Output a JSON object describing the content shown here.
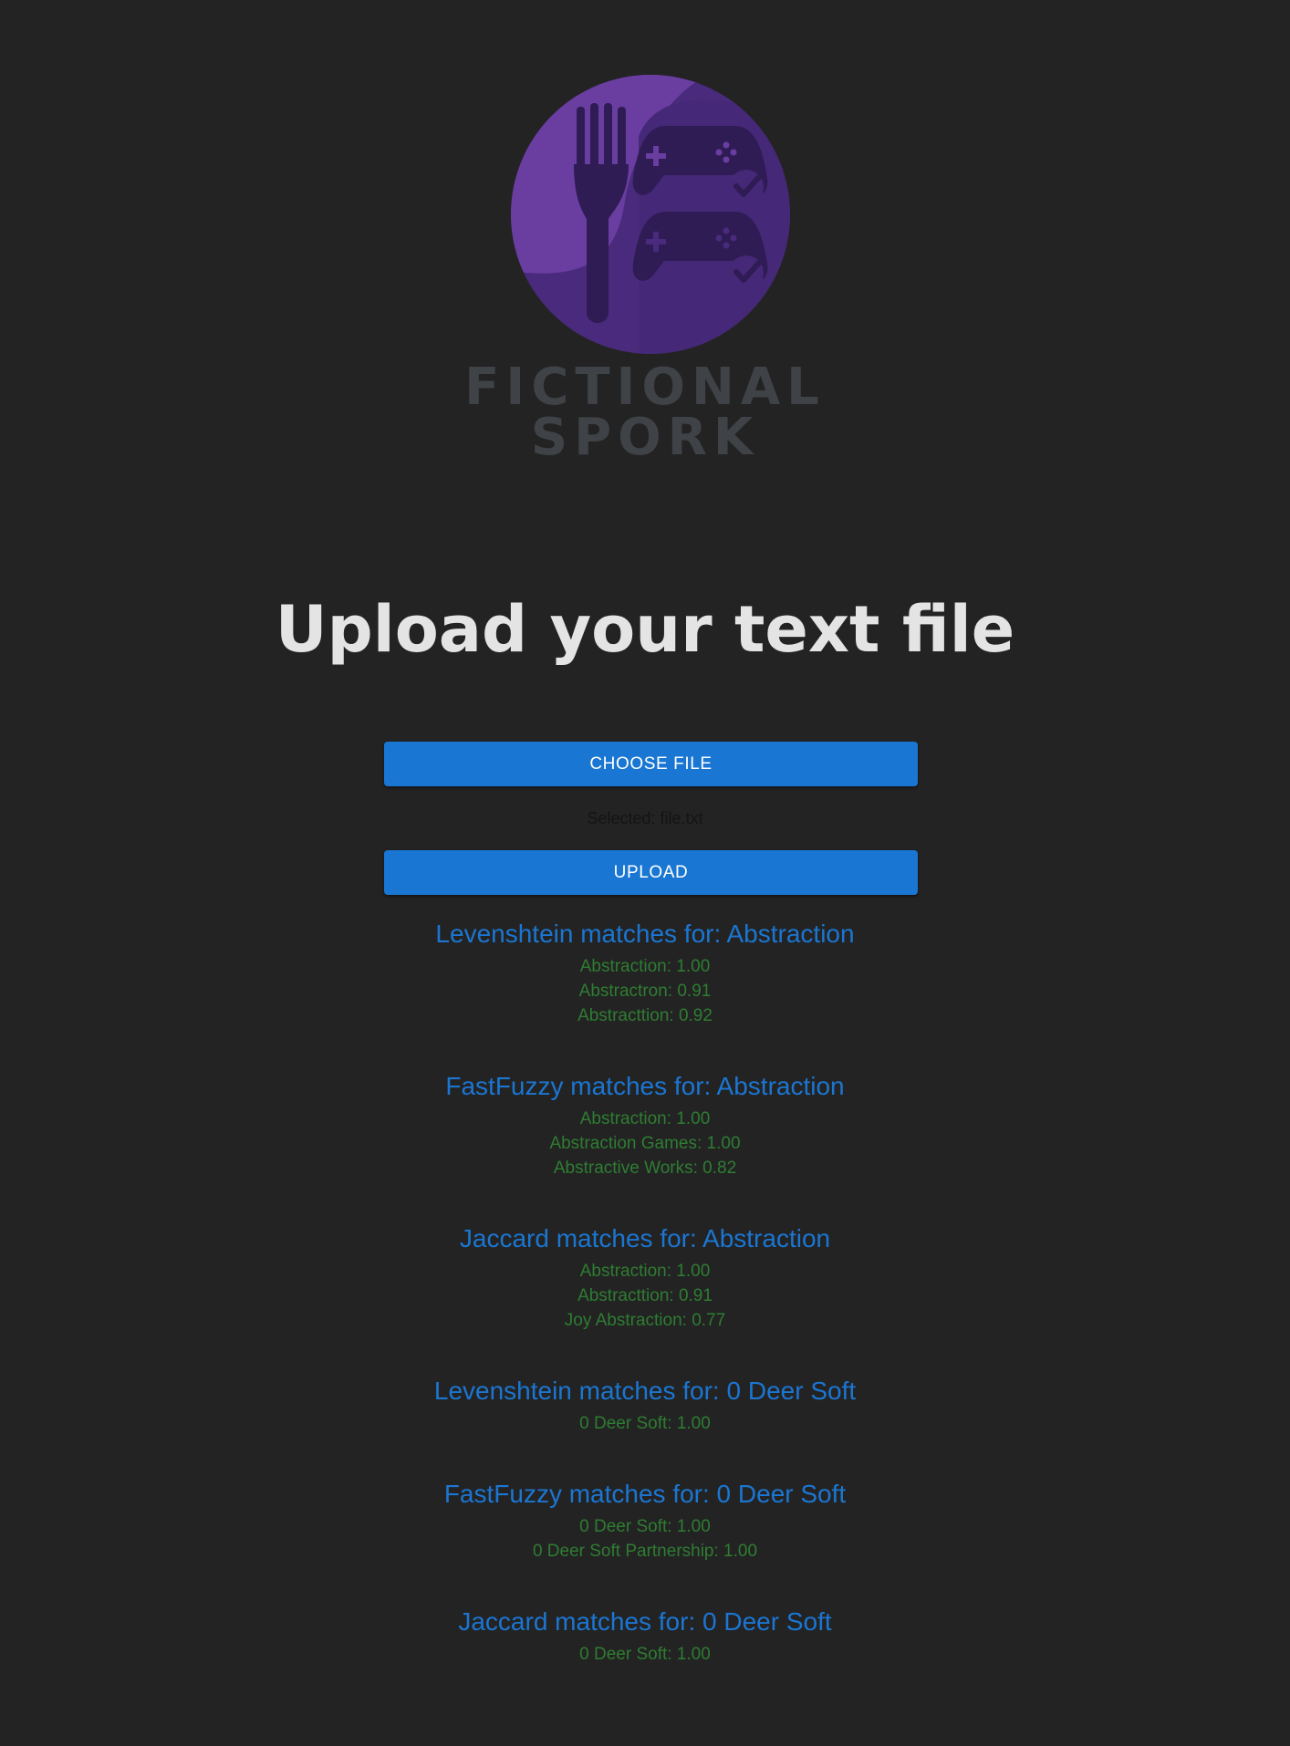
{
  "brand": {
    "line1": "FICTIONAL",
    "line2": "SPORK",
    "colors": {
      "circle_light": "#6a3ea1",
      "circle_dark": "#4a2a7c",
      "icon_dark": "#2f1c55",
      "text": "#3f4246"
    }
  },
  "page": {
    "title": "Upload your text file",
    "background": "#232323"
  },
  "buttons": {
    "choose_file_label": "CHOOSE FILE",
    "upload_label": "UPLOAD",
    "color": "#1976d2"
  },
  "file": {
    "selected_text": "Selected: file.txt"
  },
  "results": [
    {
      "heading": "Levenshtein matches for: Abstraction",
      "matches": [
        "Abstraction: 1.00",
        "Abstractron: 0.91",
        "Abstracttion: 0.92"
      ]
    },
    {
      "heading": "FastFuzzy matches for: Abstraction",
      "matches": [
        "Abstraction: 1.00",
        "Abstraction Games: 1.00",
        "Abstractive Works: 0.82"
      ]
    },
    {
      "heading": "Jaccard matches for: Abstraction",
      "matches": [
        "Abstraction: 1.00",
        "Abstracttion: 0.91",
        "Joy Abstraction: 0.77"
      ]
    },
    {
      "heading": "Levenshtein matches for: 0 Deer Soft",
      "matches": [
        "0 Deer Soft: 1.00"
      ]
    },
    {
      "heading": "FastFuzzy matches for: 0 Deer Soft",
      "matches": [
        "0 Deer Soft: 1.00",
        "0 Deer Soft Partnership: 1.00"
      ]
    },
    {
      "heading": "Jaccard matches for: 0 Deer Soft",
      "matches": [
        "0 Deer Soft: 1.00"
      ]
    }
  ],
  "icons": [
    "fork-icon",
    "gamepad-icon",
    "checkmark-icon"
  ]
}
